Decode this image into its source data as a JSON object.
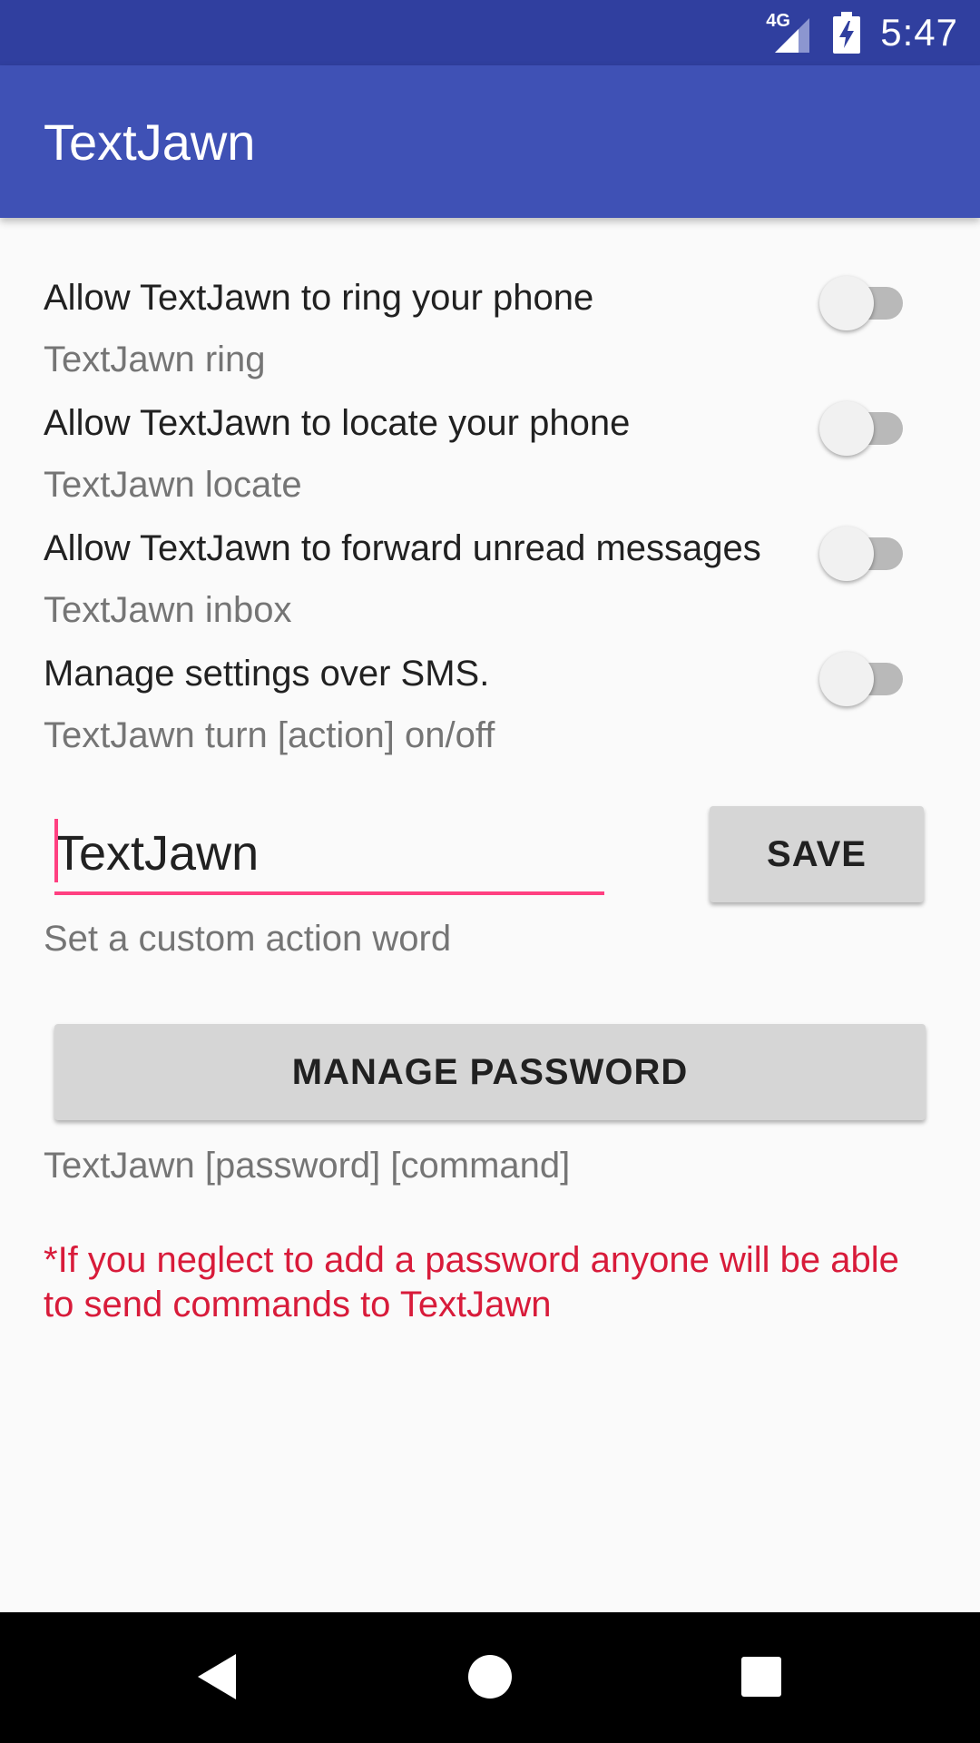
{
  "status_bar": {
    "network": "4G",
    "time": "5:47",
    "icons": [
      "signal-icon",
      "battery-charging-icon"
    ]
  },
  "app_bar": {
    "title": "TextJawn",
    "color": "#3f51b5",
    "status_color": "#303f9f"
  },
  "settings": [
    {
      "title": "Allow TextJawn to ring your phone",
      "subtitle": "TextJawn ring",
      "enabled": false
    },
    {
      "title": "Allow TextJawn to locate your phone",
      "subtitle": "TextJawn locate",
      "enabled": false
    },
    {
      "title": "Allow TextJawn to forward unread messages",
      "subtitle": "TextJawn inbox",
      "enabled": false
    },
    {
      "title": "Manage settings over SMS.",
      "subtitle": "TextJawn turn [action] on/off",
      "enabled": false
    }
  ],
  "action_word": {
    "value": "TextJawn",
    "save_label": "SAVE",
    "helper": "Set a custom action word"
  },
  "password": {
    "button_label": "MANAGE PASSWORD",
    "helper": "TextJawn [password] [command]",
    "warning": "*If you neglect to add a password anyone will be able to send commands to TextJawn"
  },
  "colors": {
    "accent": "#ff4081",
    "warning": "#d81b3a"
  },
  "nav_bar": {
    "icons": [
      "back-icon",
      "home-icon",
      "recents-icon"
    ]
  }
}
